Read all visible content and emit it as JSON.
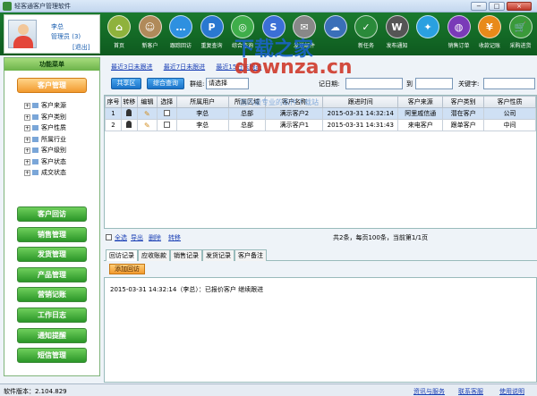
{
  "window": {
    "title": "轻客通客户管理软件",
    "min": "−",
    "max": "□",
    "close": "×"
  },
  "user": {
    "name": "李总",
    "role": "管理员 (3)",
    "logout": "[退出]"
  },
  "toolbar": [
    {
      "label": "首页",
      "icon": "home-icon",
      "color": "#8fb23c",
      "glyph": "⌂"
    },
    {
      "label": "新客户",
      "icon": "new-customer-icon",
      "color": "#b08a5a",
      "glyph": "☺"
    },
    {
      "label": "跟踪回访",
      "icon": "chat-icon",
      "color": "#2e90e0",
      "glyph": "…"
    },
    {
      "label": "重复查询",
      "icon": "query-icon",
      "color": "#2a78d0",
      "glyph": "P"
    },
    {
      "label": "综合查询",
      "icon": "search-icon",
      "color": "#3fae4a",
      "glyph": "◎"
    },
    {
      "label": "",
      "icon": "skype-icon",
      "color": "#3b6fd6",
      "glyph": "S"
    },
    {
      "label": "发送邮件",
      "icon": "mail-icon",
      "color": "#888888",
      "glyph": "✉"
    },
    {
      "label": "",
      "icon": "network-icon",
      "color": "#3a6fb8",
      "glyph": "☁"
    },
    {
      "label": "新任务",
      "icon": "task-icon",
      "color": "#2a8a3a",
      "glyph": "✓"
    },
    {
      "label": "发布通知",
      "icon": "wordpress-icon",
      "color": "#555555",
      "glyph": "W"
    },
    {
      "label": "",
      "icon": "twitter-icon",
      "color": "#2aa0e0",
      "glyph": "✦"
    },
    {
      "label": "销售订单",
      "icon": "order-icon",
      "color": "#7a3ab8",
      "glyph": "◍"
    },
    {
      "label": "收款记账",
      "icon": "payment-icon",
      "color": "#e88a1a",
      "glyph": "¥"
    },
    {
      "label": "采购进货",
      "icon": "purchase-icon",
      "color": "#3a9a3a",
      "glyph": "🛒"
    }
  ],
  "sidebar": {
    "title": "功能菜单",
    "active": "客户管理",
    "tree": [
      "客户来源",
      "客户类别",
      "客户性质",
      "所属行业",
      "客户级别",
      "客户状态",
      "成交状态"
    ],
    "buttons": [
      "客户回访",
      "销售管理",
      "发货管理",
      "产品管理",
      "营销记账",
      "工作日志",
      "通知提醒",
      "短信管理"
    ]
  },
  "quick_links": [
    "最近3日未跟进",
    "最近7日未跟进",
    "最近15日未跟进"
  ],
  "filter": {
    "share": "共享区",
    "combined": "综合查询",
    "group_label": "群组:",
    "group_value": "请选择",
    "record_label": "记日期:",
    "to_label": "到",
    "keyword_label": "关键字:"
  },
  "table": {
    "headers": [
      "序号",
      "转移",
      "编辑",
      "选择",
      "所属用户",
      "所属区域",
      "客户名称",
      "跟进时间",
      "客户来源",
      "客户类别",
      "客户性质"
    ],
    "rows": [
      [
        "1",
        "",
        "",
        "",
        "李总",
        "总部",
        "满示客户2",
        "2015-03-31 14:32:14",
        "阿里戚信通",
        "潜在客户",
        "公司"
      ],
      [
        "2",
        "",
        "",
        "",
        "李总",
        "总部",
        "满示客户1",
        "2015-03-31 14:31:43",
        "来电客户",
        "跟单客户",
        "中间"
      ]
    ]
  },
  "grid_footer": {
    "select_all": "全选",
    "export": "导出",
    "delete": "删除",
    "transfer": "转移",
    "paging": "共2条，每页100条，当前第1/1页"
  },
  "tabs": [
    "回访记录",
    "应收账款",
    "销售记录",
    "发货记录",
    "客户备注"
  ],
  "add_button": "添加回访",
  "note_text": "2015-03-31 14:32:14（李总）：已报价客户 继续跟进",
  "status": {
    "version": "软件版本：2.104.829",
    "links": [
      "资讯与服务",
      "联系客服",
      "使用说明"
    ]
  },
  "watermark": {
    "line1": "下载之家",
    "line2": "downza.cn",
    "line3": "国内最专业的软件下载站"
  }
}
